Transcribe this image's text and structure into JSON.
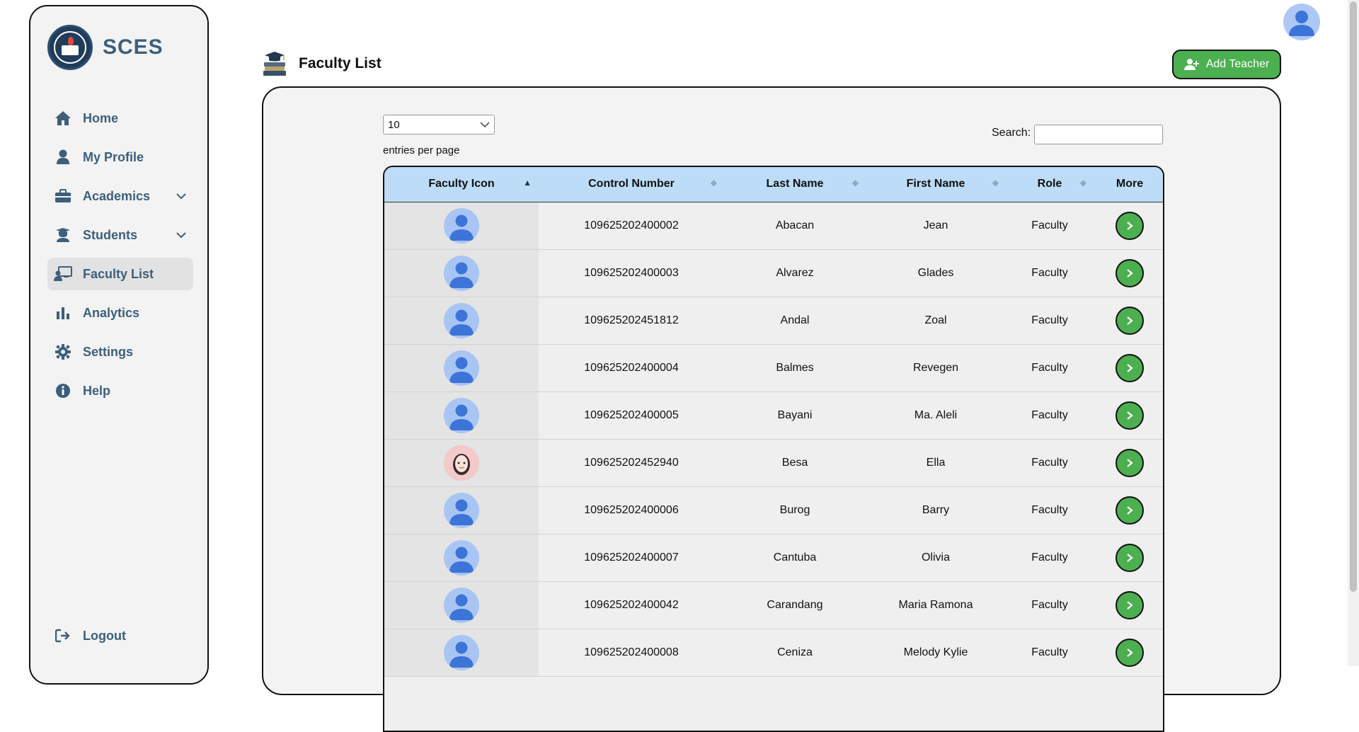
{
  "brand": {
    "name": "SCES"
  },
  "nav": {
    "items": [
      {
        "label": "Home",
        "icon": "home-icon"
      },
      {
        "label": "My Profile",
        "icon": "user-icon"
      },
      {
        "label": "Academics",
        "icon": "briefcase-icon",
        "has_submenu": true
      },
      {
        "label": "Students",
        "icon": "graduate-icon",
        "has_submenu": true
      },
      {
        "label": "Faculty List",
        "icon": "teacher-icon",
        "active": true
      },
      {
        "label": "Analytics",
        "icon": "bar-chart-icon"
      },
      {
        "label": "Settings",
        "icon": "gear-icon"
      },
      {
        "label": "Help",
        "icon": "info-icon"
      }
    ],
    "logout_label": "Logout"
  },
  "page": {
    "title": "Faculty List"
  },
  "actions": {
    "add_teacher_label": "Add Teacher"
  },
  "controls": {
    "page_length": "10",
    "entries_label": "entries per page",
    "search_label": "Search:",
    "search_value": ""
  },
  "table": {
    "columns": [
      "Faculty Icon",
      "Control Number",
      "Last Name",
      "First Name",
      "Role",
      "More"
    ],
    "rows": [
      {
        "avatar": "default",
        "control": "109625202400002",
        "last": "Abacan",
        "first": "Jean",
        "role": "Faculty"
      },
      {
        "avatar": "default",
        "control": "109625202400003",
        "last": "Alvarez",
        "first": "Glades",
        "role": "Faculty"
      },
      {
        "avatar": "default",
        "control": "109625202451812",
        "last": "Andal",
        "first": "Zoal",
        "role": "Faculty"
      },
      {
        "avatar": "default",
        "control": "109625202400004",
        "last": "Balmes",
        "first": "Revegen",
        "role": "Faculty"
      },
      {
        "avatar": "default",
        "control": "109625202400005",
        "last": "Bayani",
        "first": "Ma. Aleli",
        "role": "Faculty"
      },
      {
        "avatar": "photo",
        "control": "109625202452940",
        "last": "Besa",
        "first": "Ella",
        "role": "Faculty"
      },
      {
        "avatar": "default",
        "control": "109625202400006",
        "last": "Burog",
        "first": "Barry",
        "role": "Faculty"
      },
      {
        "avatar": "default",
        "control": "109625202400007",
        "last": "Cantuba",
        "first": "Olivia",
        "role": "Faculty"
      },
      {
        "avatar": "default",
        "control": "109625202400042",
        "last": "Carandang",
        "first": "Maria Ramona",
        "role": "Faculty"
      },
      {
        "avatar": "default",
        "control": "109625202400008",
        "last": "Ceniza",
        "first": "Melody Kylie",
        "role": "Faculty"
      }
    ]
  },
  "colors": {
    "accent_green": "#4caf50",
    "nav_text": "#3c5f7c",
    "header_blue": "#bcdcf7",
    "avatar_blue": "#a9c5f3"
  }
}
